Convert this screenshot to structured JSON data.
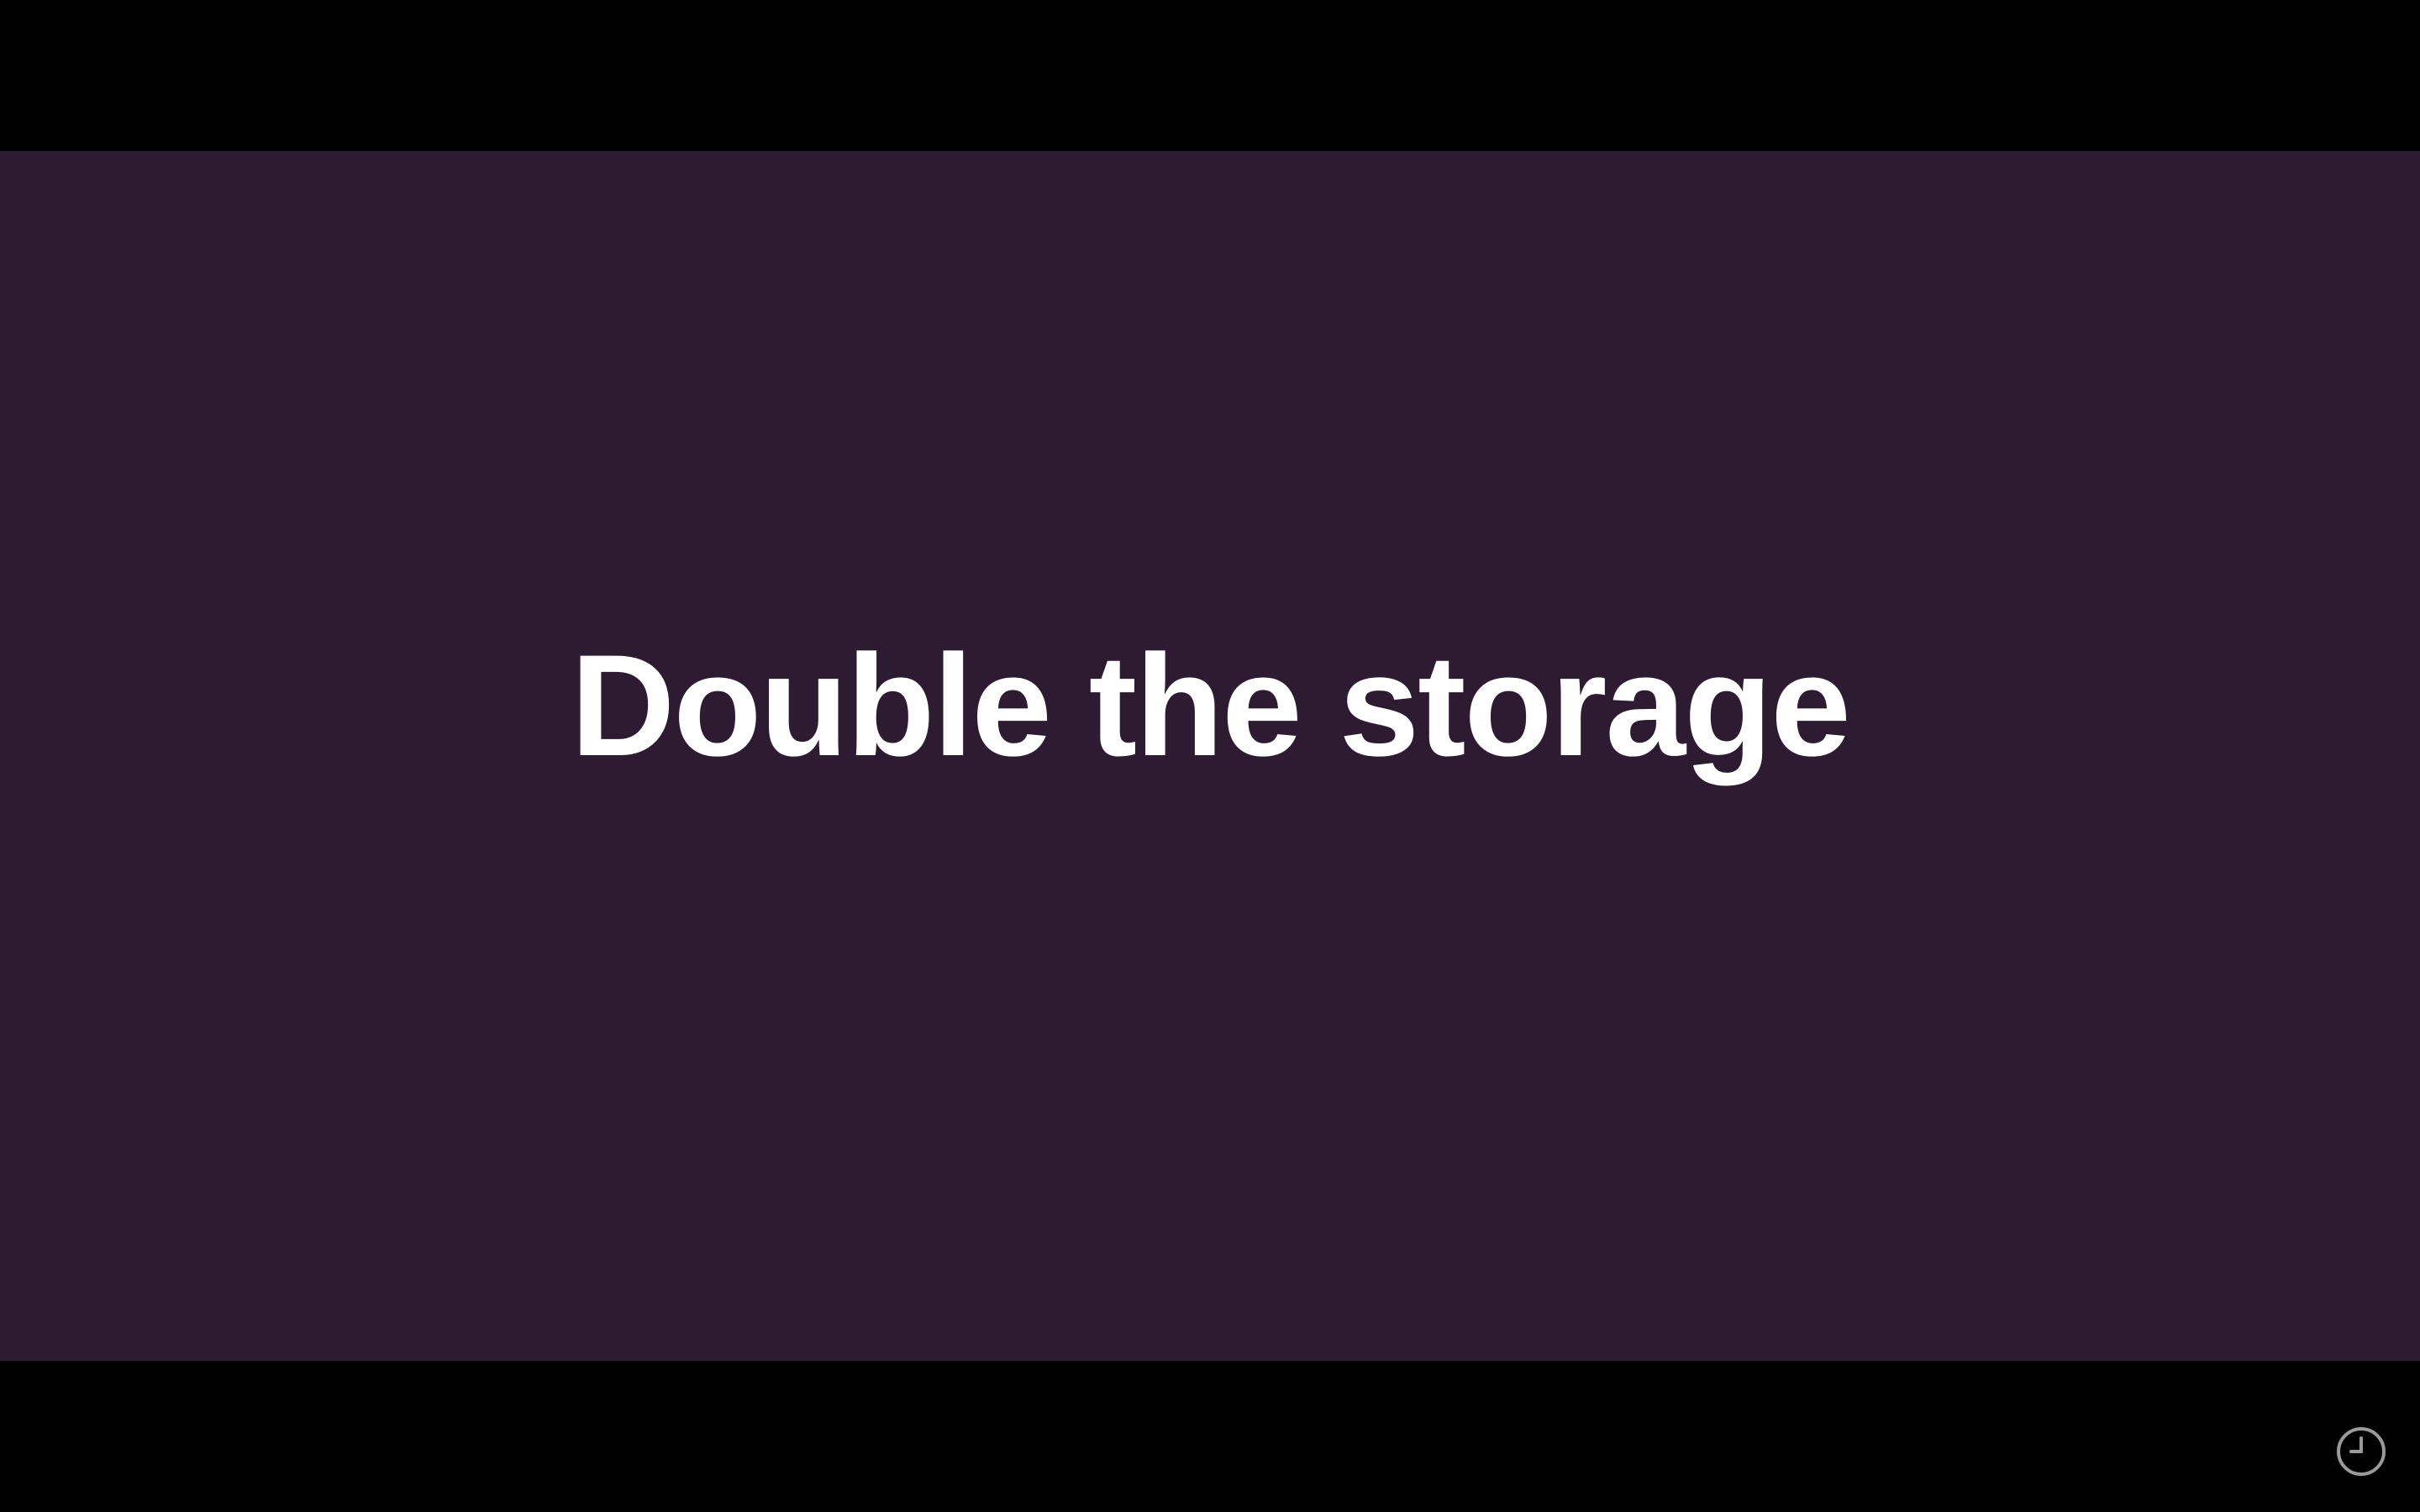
{
  "slide": {
    "title": "Double the storage",
    "background_color": "#2d1b32",
    "text_color": "#ffffff"
  },
  "letterbox": {
    "color": "#000000"
  },
  "controls": {
    "timer_icon": "clock-icon",
    "icon_color": "#9a9a9a"
  }
}
